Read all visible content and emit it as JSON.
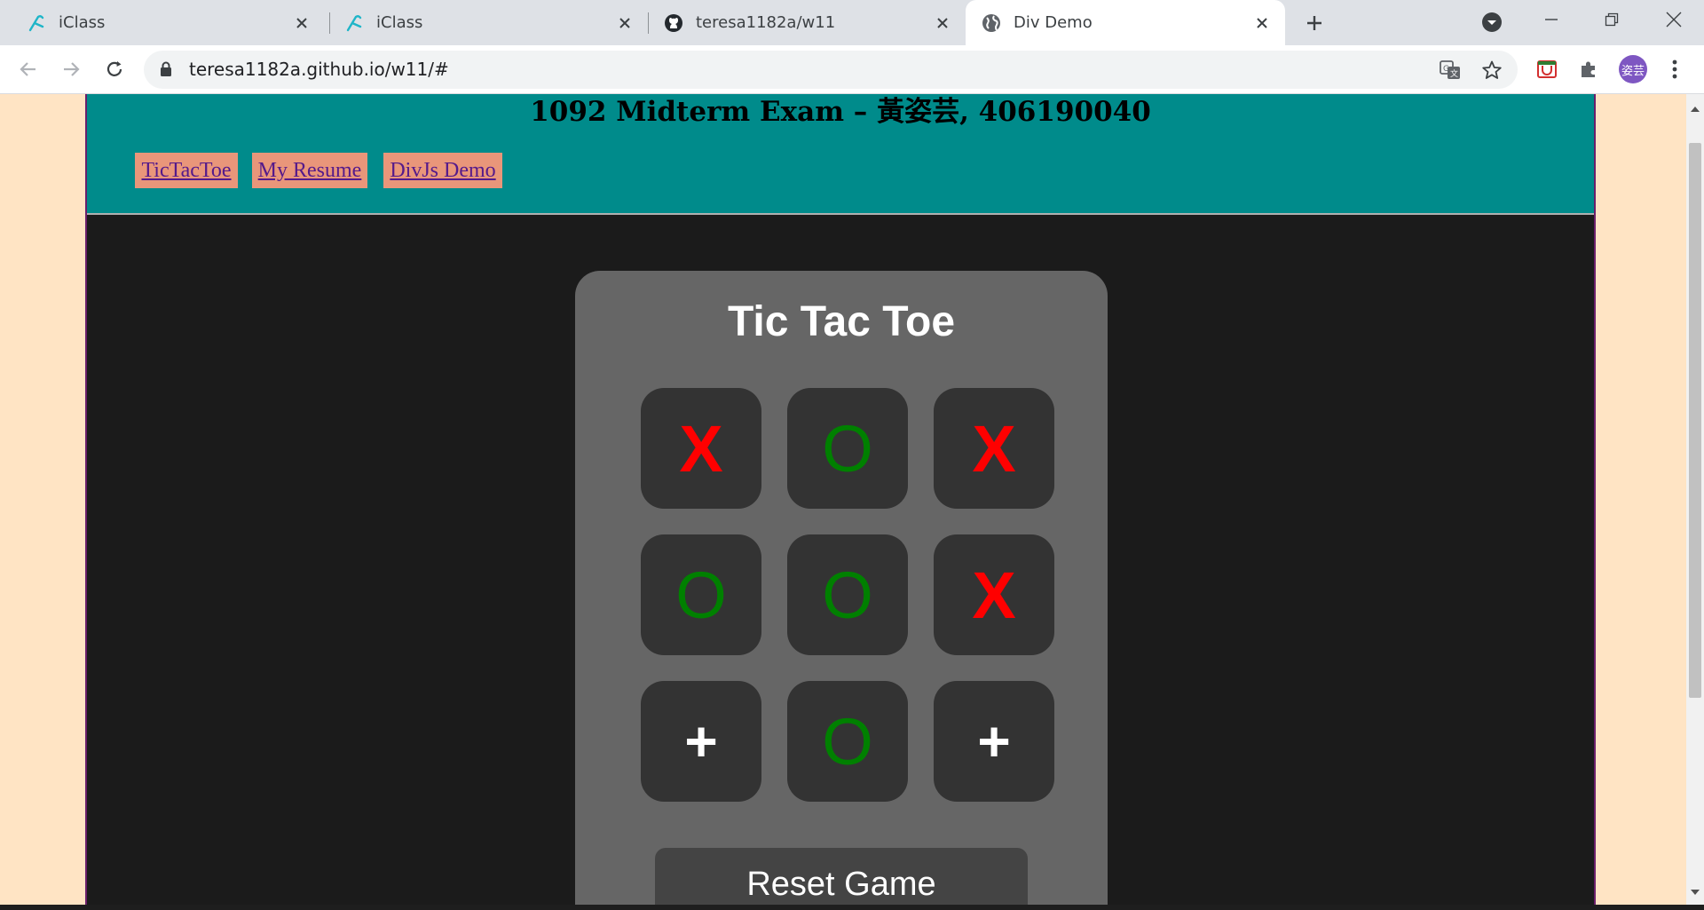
{
  "browser": {
    "tabs": [
      {
        "title": "iClass",
        "icon": "iclass-icon"
      },
      {
        "title": "iClass",
        "icon": "iclass-icon"
      },
      {
        "title": "teresa1182a/w11",
        "icon": "github-icon"
      },
      {
        "title": "Div Demo",
        "icon": "globe-icon",
        "active": true
      }
    ],
    "url": "teresa1182a.github.io/w11/#",
    "profile_initials": "姿芸"
  },
  "page": {
    "header_title": "1092 Midterm Exam – 黃姿芸, 406190040",
    "nav_links": [
      "TicTacToe",
      "My Resume",
      "DivJs Demo"
    ],
    "game": {
      "title": "Tic Tac Toe",
      "board": [
        "X",
        "O",
        "X",
        "O",
        "O",
        "X",
        "+",
        "O",
        "+"
      ],
      "reset_label": "Reset Game"
    }
  },
  "colors": {
    "page_bg": "#ffe4c4",
    "header_bg": "#008b8b",
    "nav_link_bg": "#e9967a",
    "content_bg": "#1b1b1b",
    "card_bg": "#666666",
    "cell_bg": "#333333",
    "x_color": "#ff0000",
    "o_color": "#008000"
  }
}
